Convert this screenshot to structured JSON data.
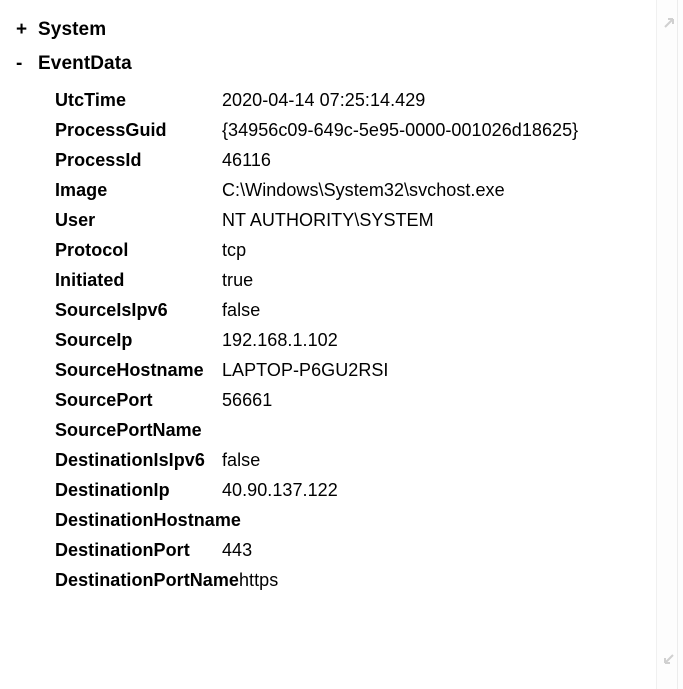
{
  "tree": {
    "nodes": [
      {
        "toggle": "+",
        "label": "System",
        "expanded": false
      },
      {
        "toggle": "-",
        "label": "EventData",
        "expanded": true
      }
    ]
  },
  "event_data": {
    "rows": [
      {
        "key": "UtcTime",
        "value": "2020-04-14 07:25:14.429"
      },
      {
        "key": "ProcessGuid",
        "value": "{34956c09-649c-5e95-0000-001026d18625}"
      },
      {
        "key": "ProcessId",
        "value": "46116"
      },
      {
        "key": "Image",
        "value": "C:\\Windows\\System32\\svchost.exe"
      },
      {
        "key": "User",
        "value": "NT AUTHORITY\\SYSTEM"
      },
      {
        "key": "Protocol",
        "value": "tcp"
      },
      {
        "key": "Initiated",
        "value": "true"
      },
      {
        "key": "SourceIsIpv6",
        "value": "false"
      },
      {
        "key": "SourceIp",
        "value": "192.168.1.102"
      },
      {
        "key": "SourceHostname",
        "value": "LAPTOP-P6GU2RSI"
      },
      {
        "key": "SourcePort",
        "value": "56661"
      },
      {
        "key": "SourcePortName",
        "value": ""
      },
      {
        "key": "DestinationIsIpv6",
        "value": "false"
      },
      {
        "key": "DestinationIp",
        "value": "40.90.137.122"
      },
      {
        "key": "DestinationHostname",
        "value": ""
      },
      {
        "key": "DestinationPort",
        "value": "443"
      },
      {
        "key": "DestinationPortName",
        "value": "https"
      }
    ]
  },
  "scrollbar": {
    "up_icon": "scroll-up-arrow-icon",
    "down_icon": "scroll-down-arrow-icon"
  },
  "colors": {
    "background": "#ffffff",
    "text": "#000000",
    "scrollbar_track": "#fdfdfd",
    "scrollbar_divider": "#ececec"
  }
}
